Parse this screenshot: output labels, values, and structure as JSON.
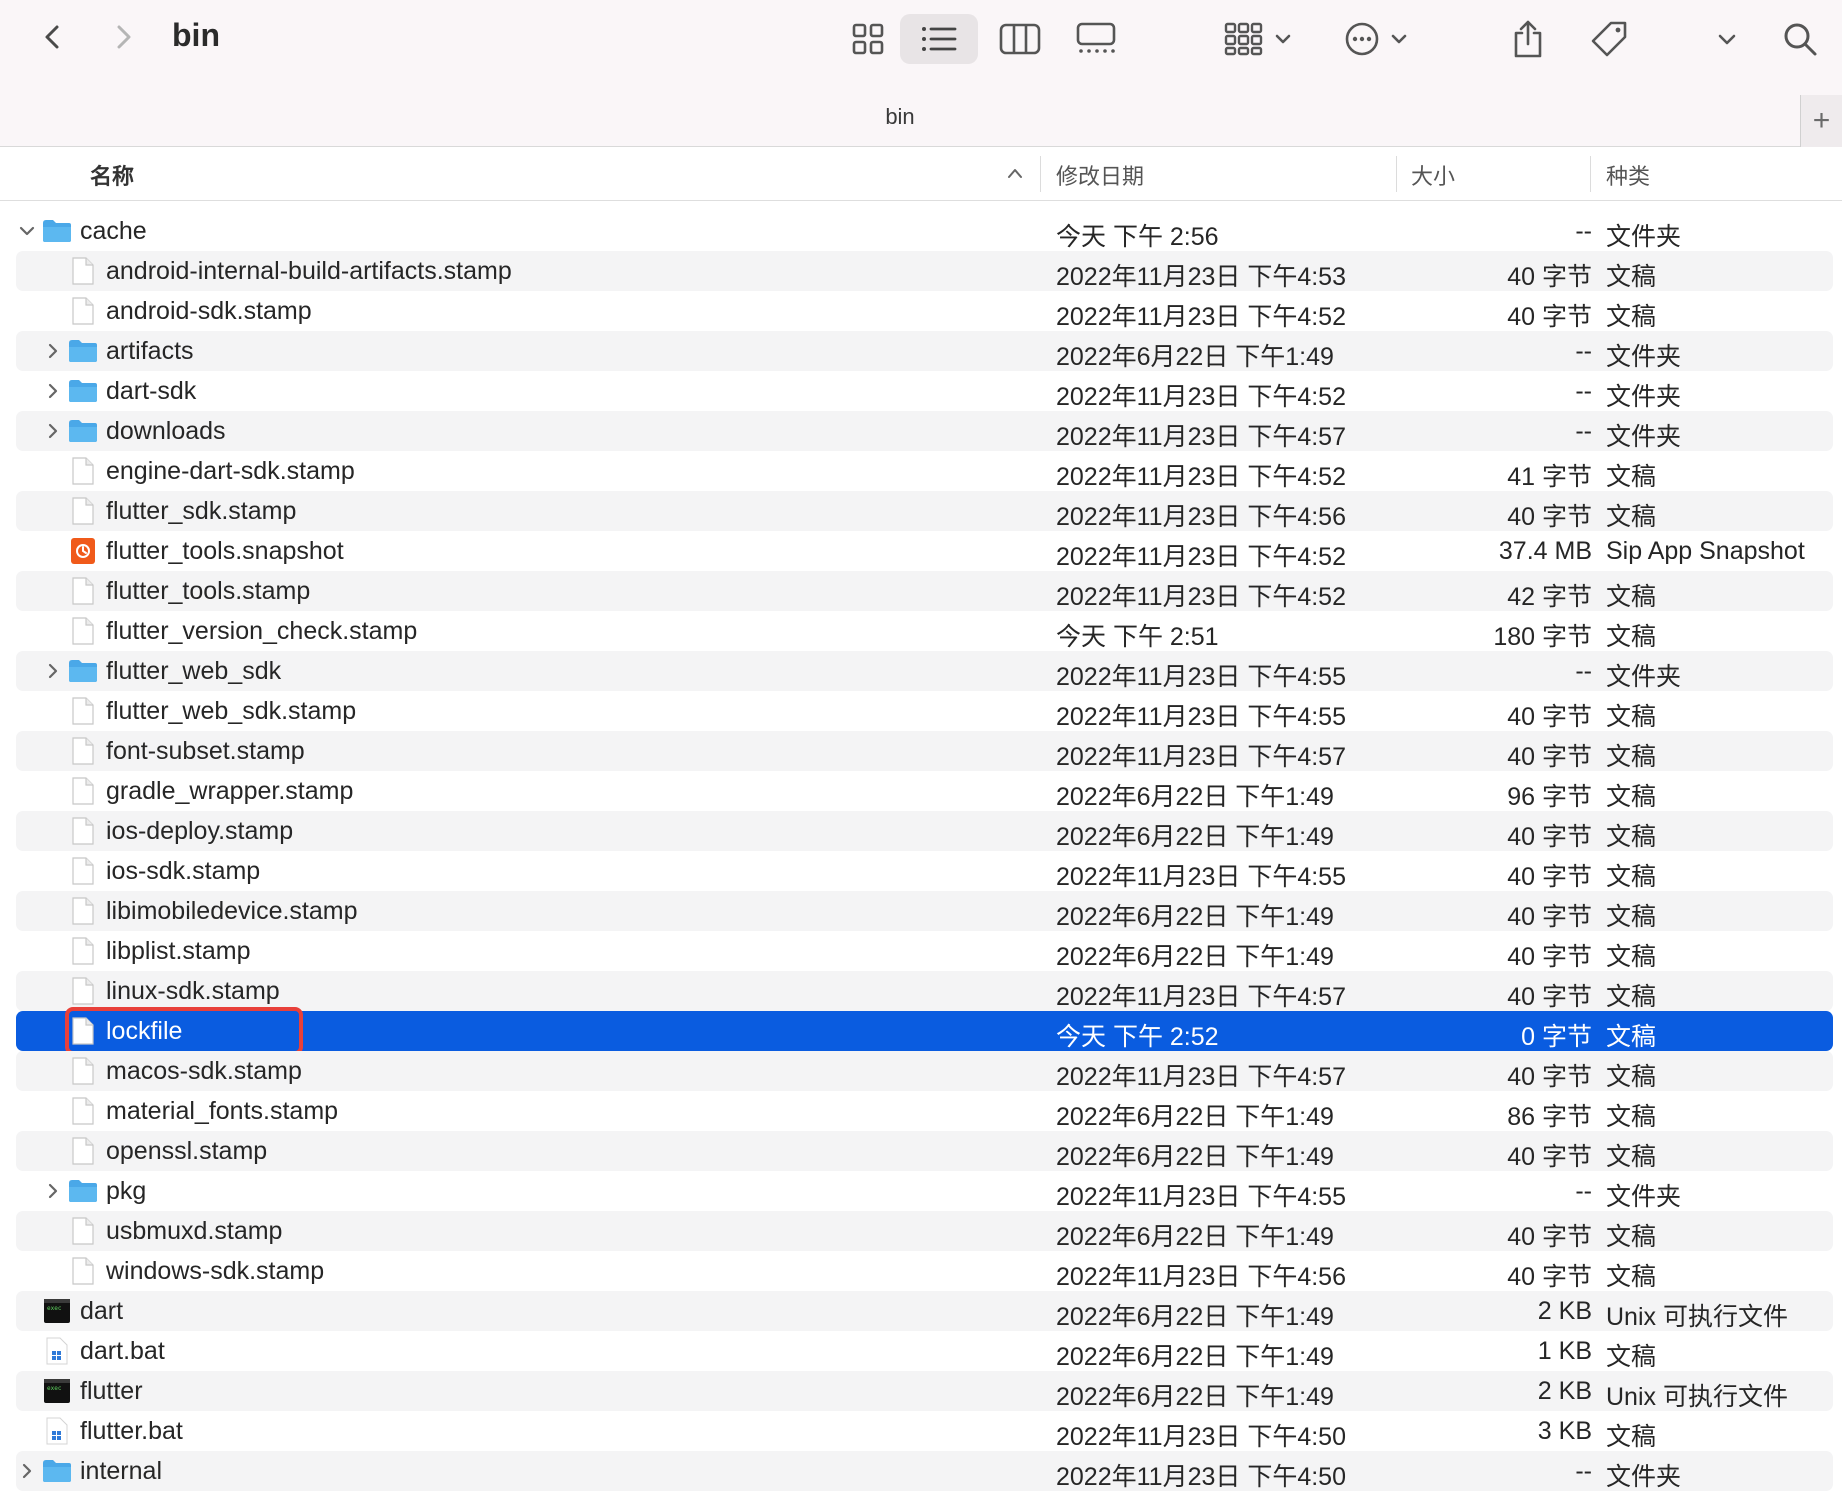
{
  "window": {
    "title": "bin",
    "tab_title": "bin"
  },
  "toolbar": {
    "icons": [
      "chevron-left-icon",
      "chevron-right-icon",
      "icon-view-icon",
      "list-view-icon",
      "column-view-icon",
      "gallery-view-icon",
      "group-icon",
      "more-actions-icon",
      "share-icon",
      "tag-icon",
      "chevron-down-icon",
      "search-icon"
    ],
    "add_tab": "+"
  },
  "columns": {
    "name": "名称",
    "date": "修改日期",
    "size": "大小",
    "kind": "种类"
  },
  "colors": {
    "folder": "#5cb8f0",
    "selection": "#0a5ce0",
    "highlight_border": "#e8403a",
    "snapshot_icon": "#f05a1a"
  },
  "rows": [
    {
      "name": "cache",
      "date": "今天 下午 2:56",
      "size": "--",
      "kind": "文件夹",
      "type": "folder",
      "level": 0,
      "expanded": true
    },
    {
      "name": "android-internal-build-artifacts.stamp",
      "date": "2022年11月23日 下午4:53",
      "size": "40 字节",
      "kind": "文稿",
      "type": "file",
      "level": 1
    },
    {
      "name": "android-sdk.stamp",
      "date": "2022年11月23日 下午4:52",
      "size": "40 字节",
      "kind": "文稿",
      "type": "file",
      "level": 1
    },
    {
      "name": "artifacts",
      "date": "2022年6月22日 下午1:49",
      "size": "--",
      "kind": "文件夹",
      "type": "folder",
      "level": 1,
      "expanded": false
    },
    {
      "name": "dart-sdk",
      "date": "2022年11月23日 下午4:52",
      "size": "--",
      "kind": "文件夹",
      "type": "folder",
      "level": 1,
      "expanded": false
    },
    {
      "name": "downloads",
      "date": "2022年11月23日 下午4:57",
      "size": "--",
      "kind": "文件夹",
      "type": "folder",
      "level": 1,
      "expanded": false
    },
    {
      "name": "engine-dart-sdk.stamp",
      "date": "2022年11月23日 下午4:52",
      "size": "41 字节",
      "kind": "文稿",
      "type": "file",
      "level": 1
    },
    {
      "name": "flutter_sdk.stamp",
      "date": "2022年11月23日 下午4:56",
      "size": "40 字节",
      "kind": "文稿",
      "type": "file",
      "level": 1
    },
    {
      "name": "flutter_tools.snapshot",
      "date": "2022年11月23日 下午4:52",
      "size": "37.4 MB",
      "kind": "Sip App Snapshot",
      "type": "snapshot",
      "level": 1
    },
    {
      "name": "flutter_tools.stamp",
      "date": "2022年11月23日 下午4:52",
      "size": "42 字节",
      "kind": "文稿",
      "type": "file",
      "level": 1
    },
    {
      "name": "flutter_version_check.stamp",
      "date": "今天 下午 2:51",
      "size": "180 字节",
      "kind": "文稿",
      "type": "file",
      "level": 1
    },
    {
      "name": "flutter_web_sdk",
      "date": "2022年11月23日 下午4:55",
      "size": "--",
      "kind": "文件夹",
      "type": "folder",
      "level": 1,
      "expanded": false
    },
    {
      "name": "flutter_web_sdk.stamp",
      "date": "2022年11月23日 下午4:55",
      "size": "40 字节",
      "kind": "文稿",
      "type": "file",
      "level": 1
    },
    {
      "name": "font-subset.stamp",
      "date": "2022年11月23日 下午4:57",
      "size": "40 字节",
      "kind": "文稿",
      "type": "file",
      "level": 1
    },
    {
      "name": "gradle_wrapper.stamp",
      "date": "2022年6月22日 下午1:49",
      "size": "96 字节",
      "kind": "文稿",
      "type": "file",
      "level": 1
    },
    {
      "name": "ios-deploy.stamp",
      "date": "2022年6月22日 下午1:49",
      "size": "40 字节",
      "kind": "文稿",
      "type": "file",
      "level": 1
    },
    {
      "name": "ios-sdk.stamp",
      "date": "2022年11月23日 下午4:55",
      "size": "40 字节",
      "kind": "文稿",
      "type": "file",
      "level": 1
    },
    {
      "name": "libimobiledevice.stamp",
      "date": "2022年6月22日 下午1:49",
      "size": "40 字节",
      "kind": "文稿",
      "type": "file",
      "level": 1
    },
    {
      "name": "libplist.stamp",
      "date": "2022年6月22日 下午1:49",
      "size": "40 字节",
      "kind": "文稿",
      "type": "file",
      "level": 1
    },
    {
      "name": "linux-sdk.stamp",
      "date": "2022年11月23日 下午4:57",
      "size": "40 字节",
      "kind": "文稿",
      "type": "file",
      "level": 1
    },
    {
      "name": "lockfile",
      "date": "今天 下午 2:52",
      "size": "0 字节",
      "kind": "文稿",
      "type": "file",
      "level": 1,
      "selected": true,
      "highlighted": true
    },
    {
      "name": "macos-sdk.stamp",
      "date": "2022年11月23日 下午4:57",
      "size": "40 字节",
      "kind": "文稿",
      "type": "file",
      "level": 1
    },
    {
      "name": "material_fonts.stamp",
      "date": "2022年6月22日 下午1:49",
      "size": "86 字节",
      "kind": "文稿",
      "type": "file",
      "level": 1
    },
    {
      "name": "openssl.stamp",
      "date": "2022年6月22日 下午1:49",
      "size": "40 字节",
      "kind": "文稿",
      "type": "file",
      "level": 1
    },
    {
      "name": "pkg",
      "date": "2022年11月23日 下午4:55",
      "size": "--",
      "kind": "文件夹",
      "type": "folder",
      "level": 1,
      "expanded": false
    },
    {
      "name": "usbmuxd.stamp",
      "date": "2022年6月22日 下午1:49",
      "size": "40 字节",
      "kind": "文稿",
      "type": "file",
      "level": 1
    },
    {
      "name": "windows-sdk.stamp",
      "date": "2022年11月23日 下午4:56",
      "size": "40 字节",
      "kind": "文稿",
      "type": "file",
      "level": 1
    },
    {
      "name": "dart",
      "date": "2022年6月22日 下午1:49",
      "size": "2 KB",
      "kind": "Unix 可执行文件",
      "type": "exec",
      "level": 0
    },
    {
      "name": "dart.bat",
      "date": "2022年6月22日 下午1:49",
      "size": "1 KB",
      "kind": "文稿",
      "type": "bat",
      "level": 0
    },
    {
      "name": "flutter",
      "date": "2022年6月22日 下午1:49",
      "size": "2 KB",
      "kind": "Unix 可执行文件",
      "type": "exec",
      "level": 0
    },
    {
      "name": "flutter.bat",
      "date": "2022年11月23日 下午4:50",
      "size": "3 KB",
      "kind": "文稿",
      "type": "bat",
      "level": 0
    },
    {
      "name": "internal",
      "date": "2022年11月23日 下午4:50",
      "size": "--",
      "kind": "文件夹",
      "type": "folder",
      "level": 0,
      "expanded": false
    }
  ]
}
